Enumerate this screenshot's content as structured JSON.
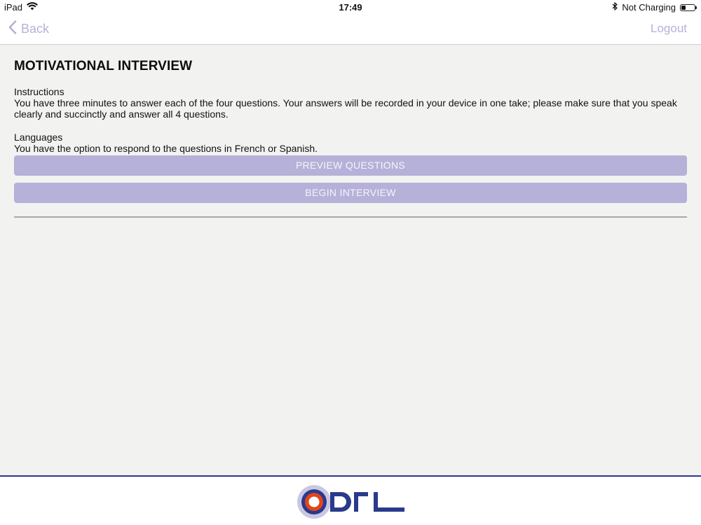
{
  "status_bar": {
    "device": "iPad",
    "time": "17:49",
    "charging_status": "Not Charging",
    "battery_level": 0.35
  },
  "nav": {
    "back_label": "Back",
    "logout_label": "Logout"
  },
  "main": {
    "title": "MOTIVATIONAL INTERVIEW",
    "instructions": {
      "heading": "Instructions",
      "body": "You have three minutes to answer each of the four questions. Your answers will be recorded in your device in one take; please make sure that you speak clearly and succinctly and answer all 4 questions."
    },
    "languages": {
      "heading": "Languages",
      "body": "You have the option to respond to the questions in French or Spanish."
    },
    "buttons": {
      "preview": "PREVIEW QUESTIONS",
      "begin": "BEGIN INTERVIEW"
    }
  },
  "footer": {
    "logo_text": "ODL"
  },
  "colors": {
    "accent": "#b6b1d8",
    "brand_navy": "#2a3a8c",
    "logo_orange": "#e2461c",
    "logo_ring": "#9f9ac8"
  }
}
